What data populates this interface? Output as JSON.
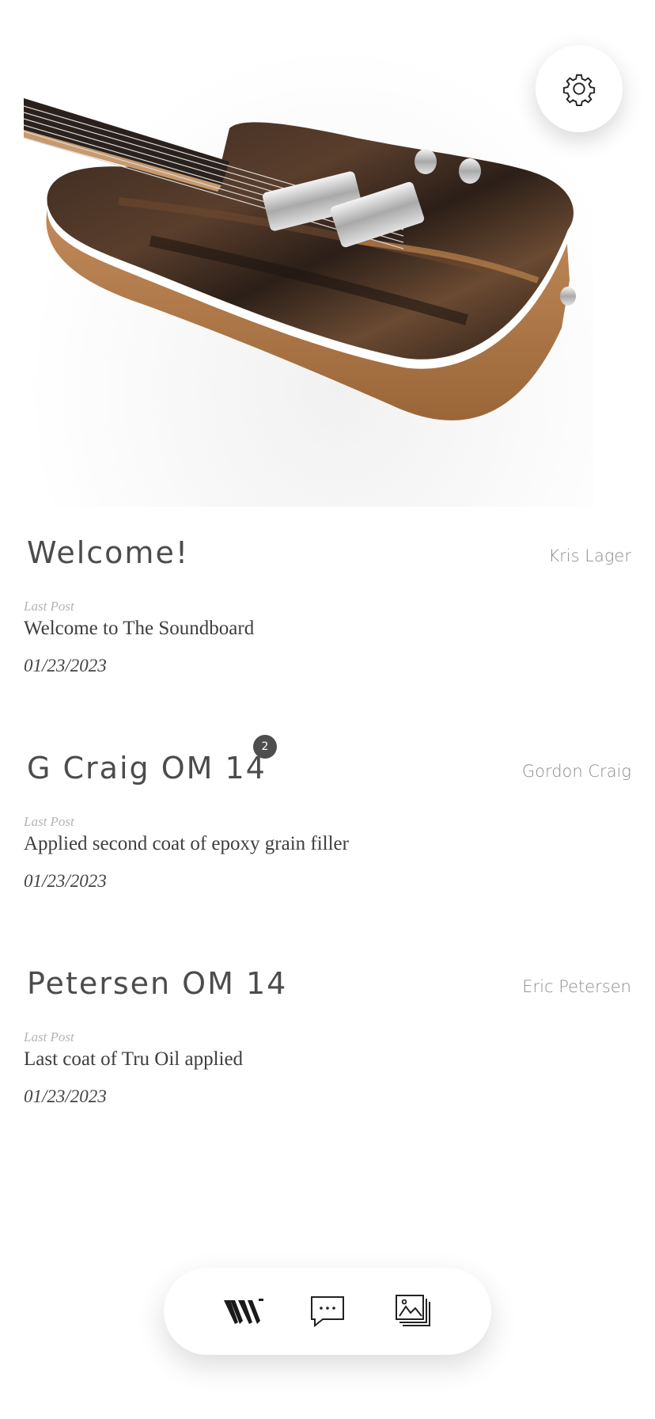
{
  "hero": {
    "image": "guitar-photo"
  },
  "settings": {
    "icon": "gear-icon"
  },
  "threads": [
    {
      "title": "Welcome!",
      "author": "Kris Lager",
      "last_post_label": "Last Post",
      "last_post": "Welcome to The Soundboard",
      "date": "01/23/2023",
      "badge": null
    },
    {
      "title": "G Craig OM 14",
      "author": "Gordon Craig",
      "last_post_label": "Last Post",
      "last_post": "Applied second coat of epoxy grain filler",
      "date": "01/23/2023",
      "badge": "2"
    },
    {
      "title": "Petersen OM 14",
      "author": "Eric Petersen",
      "last_post_label": "Last Post",
      "last_post": "Last coat of Tru Oil applied",
      "date": "01/23/2023",
      "badge": null
    }
  ],
  "bottom_nav": {
    "items": [
      {
        "icon": "logo-w-icon",
        "active": true
      },
      {
        "icon": "chat-bubble-icon",
        "active": false
      },
      {
        "icon": "gallery-icon",
        "active": false
      }
    ]
  },
  "colors": {
    "text_dark": "#4c4c4c",
    "text_muted": "#8d8d8d",
    "label_light": "#b4b4b4",
    "badge_bg": "#4e4e4e"
  }
}
